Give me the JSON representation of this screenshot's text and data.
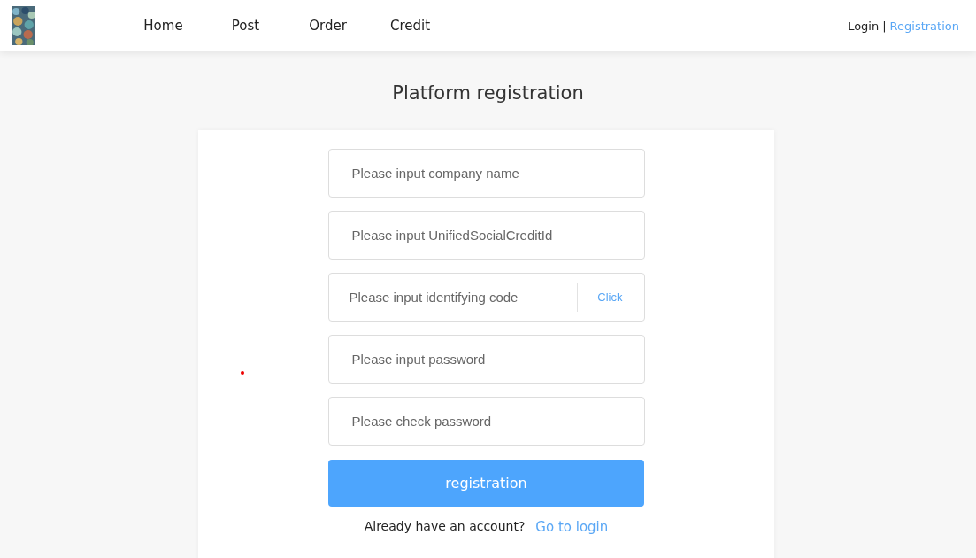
{
  "header": {
    "nav": [
      {
        "label": "Home"
      },
      {
        "label": "Post"
      },
      {
        "label": "Order"
      },
      {
        "label": "Credit"
      }
    ],
    "auth_links": [
      {
        "label": "Login",
        "selected": false
      },
      {
        "label": "Registration",
        "selected": true
      }
    ],
    "separator": "|"
  },
  "title": "Platform registration",
  "form": {
    "fields": [
      {
        "kind": "text",
        "placeholder": "Please input company name"
      },
      {
        "kind": "text",
        "placeholder": "Please input UnifiedSocialCreditId"
      },
      {
        "kind": "code",
        "placeholder": "Please input identifying code",
        "action": "Click"
      },
      {
        "kind": "password",
        "placeholder": "Please input password"
      },
      {
        "kind": "password",
        "placeholder": "Please check password"
      }
    ],
    "submit": "registration",
    "footer_text": "Already have an account?",
    "footer_link": "Go to login"
  }
}
